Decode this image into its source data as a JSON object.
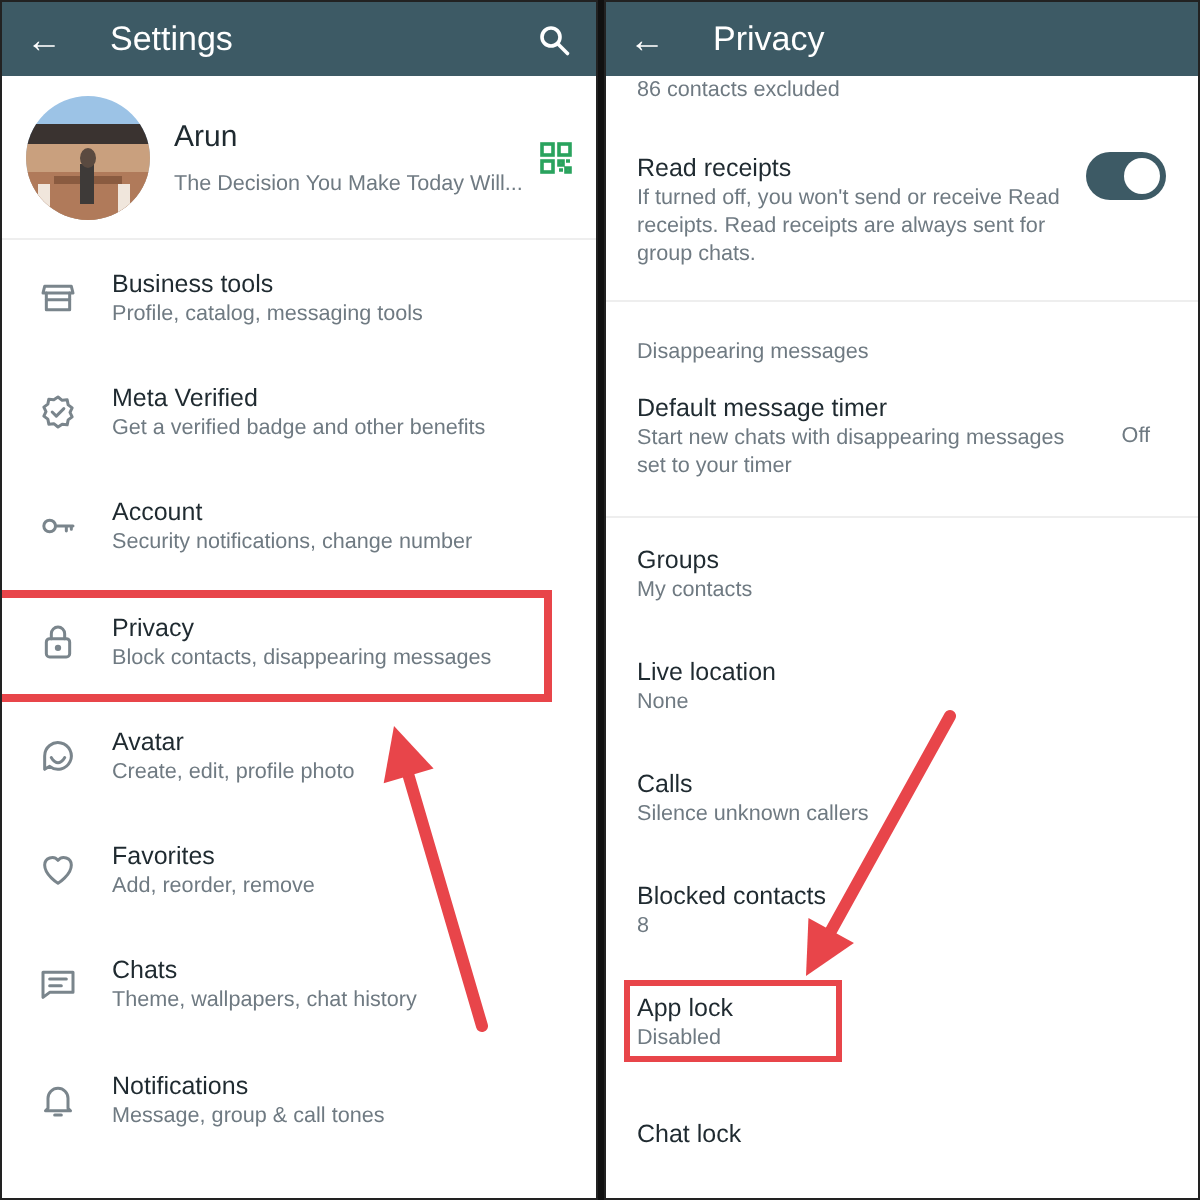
{
  "settings": {
    "title": "Settings",
    "back": "←",
    "profile": {
      "name": "Arun",
      "status": "The Decision You Make Today Will..."
    },
    "items": [
      {
        "title": "Business tools",
        "subtitle": "Profile, catalog, messaging tools",
        "highlighted": false
      },
      {
        "title": "Meta Verified",
        "subtitle": "Get a verified badge and other benefits",
        "highlighted": false
      },
      {
        "title": "Account",
        "subtitle": "Security notifications, change number",
        "highlighted": false
      },
      {
        "title": "Privacy",
        "subtitle": "Block contacts, disappearing messages",
        "highlighted": true
      },
      {
        "title": "Avatar",
        "subtitle": "Create, edit, profile photo",
        "highlighted": false
      },
      {
        "title": "Favorites",
        "subtitle": "Add, reorder, remove",
        "highlighted": false
      },
      {
        "title": "Chats",
        "subtitle": "Theme, wallpapers, chat history",
        "highlighted": false
      },
      {
        "title": "Notifications",
        "subtitle": "Message, group & call tones",
        "highlighted": false
      }
    ]
  },
  "privacy": {
    "title": "Privacy",
    "back": "←",
    "items": [
      {
        "kind": "note",
        "subtitle": "86 contacts excluded"
      },
      {
        "kind": "toggle",
        "title": "Read receipts",
        "subtitle": "If turned off, you won't send or receive Read receipts. Read receipts are always sent for group chats.",
        "on": true
      },
      {
        "kind": "section",
        "title": "Disappearing messages"
      },
      {
        "kind": "value",
        "title": "Default message timer",
        "subtitle": "Start new chats with disappearing messages set to your timer",
        "value": "Off"
      },
      {
        "kind": "plain",
        "title": "Groups",
        "subtitle": "My contacts",
        "highlighted": false
      },
      {
        "kind": "plain",
        "title": "Live location",
        "subtitle": "None",
        "highlighted": false
      },
      {
        "kind": "plain",
        "title": "Calls",
        "subtitle": "Silence unknown callers",
        "highlighted": false
      },
      {
        "kind": "plain",
        "title": "Blocked contacts",
        "subtitle": "8",
        "highlighted": false
      },
      {
        "kind": "plain",
        "title": "App lock",
        "subtitle": "Disabled",
        "highlighted": true
      },
      {
        "kind": "plain",
        "title": "Chat lock",
        "highlighted": false
      }
    ]
  }
}
